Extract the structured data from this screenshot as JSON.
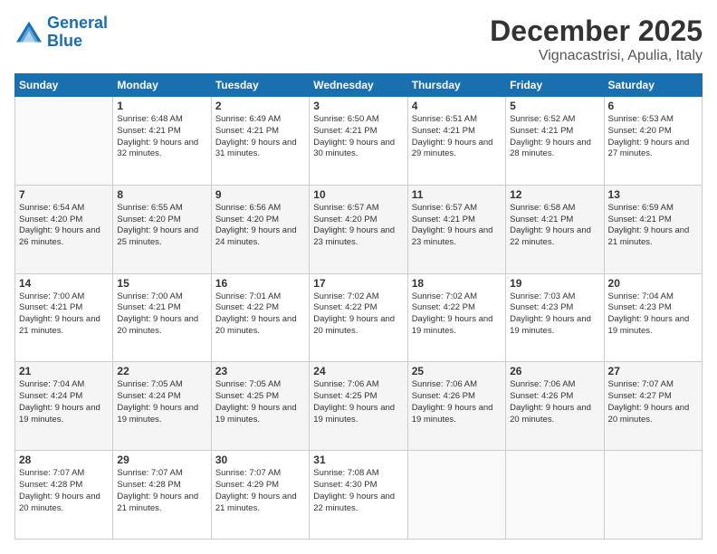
{
  "header": {
    "logo_line1": "General",
    "logo_line2": "Blue",
    "month_title": "December 2025",
    "location": "Vignacastrisi, Apulia, Italy"
  },
  "days_of_week": [
    "Sunday",
    "Monday",
    "Tuesday",
    "Wednesday",
    "Thursday",
    "Friday",
    "Saturday"
  ],
  "weeks": [
    [
      {
        "day": "",
        "info": ""
      },
      {
        "day": "1",
        "info": "Sunrise: 6:48 AM\nSunset: 4:21 PM\nDaylight: 9 hours\nand 32 minutes."
      },
      {
        "day": "2",
        "info": "Sunrise: 6:49 AM\nSunset: 4:21 PM\nDaylight: 9 hours\nand 31 minutes."
      },
      {
        "day": "3",
        "info": "Sunrise: 6:50 AM\nSunset: 4:21 PM\nDaylight: 9 hours\nand 30 minutes."
      },
      {
        "day": "4",
        "info": "Sunrise: 6:51 AM\nSunset: 4:21 PM\nDaylight: 9 hours\nand 29 minutes."
      },
      {
        "day": "5",
        "info": "Sunrise: 6:52 AM\nSunset: 4:21 PM\nDaylight: 9 hours\nand 28 minutes."
      },
      {
        "day": "6",
        "info": "Sunrise: 6:53 AM\nSunset: 4:20 PM\nDaylight: 9 hours\nand 27 minutes."
      }
    ],
    [
      {
        "day": "7",
        "info": "Sunrise: 6:54 AM\nSunset: 4:20 PM\nDaylight: 9 hours\nand 26 minutes."
      },
      {
        "day": "8",
        "info": "Sunrise: 6:55 AM\nSunset: 4:20 PM\nDaylight: 9 hours\nand 25 minutes."
      },
      {
        "day": "9",
        "info": "Sunrise: 6:56 AM\nSunset: 4:20 PM\nDaylight: 9 hours\nand 24 minutes."
      },
      {
        "day": "10",
        "info": "Sunrise: 6:57 AM\nSunset: 4:20 PM\nDaylight: 9 hours\nand 23 minutes."
      },
      {
        "day": "11",
        "info": "Sunrise: 6:57 AM\nSunset: 4:21 PM\nDaylight: 9 hours\nand 23 minutes."
      },
      {
        "day": "12",
        "info": "Sunrise: 6:58 AM\nSunset: 4:21 PM\nDaylight: 9 hours\nand 22 minutes."
      },
      {
        "day": "13",
        "info": "Sunrise: 6:59 AM\nSunset: 4:21 PM\nDaylight: 9 hours\nand 21 minutes."
      }
    ],
    [
      {
        "day": "14",
        "info": "Sunrise: 7:00 AM\nSunset: 4:21 PM\nDaylight: 9 hours\nand 21 minutes."
      },
      {
        "day": "15",
        "info": "Sunrise: 7:00 AM\nSunset: 4:21 PM\nDaylight: 9 hours\nand 20 minutes."
      },
      {
        "day": "16",
        "info": "Sunrise: 7:01 AM\nSunset: 4:22 PM\nDaylight: 9 hours\nand 20 minutes."
      },
      {
        "day": "17",
        "info": "Sunrise: 7:02 AM\nSunset: 4:22 PM\nDaylight: 9 hours\nand 20 minutes."
      },
      {
        "day": "18",
        "info": "Sunrise: 7:02 AM\nSunset: 4:22 PM\nDaylight: 9 hours\nand 19 minutes."
      },
      {
        "day": "19",
        "info": "Sunrise: 7:03 AM\nSunset: 4:23 PM\nDaylight: 9 hours\nand 19 minutes."
      },
      {
        "day": "20",
        "info": "Sunrise: 7:04 AM\nSunset: 4:23 PM\nDaylight: 9 hours\nand 19 minutes."
      }
    ],
    [
      {
        "day": "21",
        "info": "Sunrise: 7:04 AM\nSunset: 4:24 PM\nDaylight: 9 hours\nand 19 minutes."
      },
      {
        "day": "22",
        "info": "Sunrise: 7:05 AM\nSunset: 4:24 PM\nDaylight: 9 hours\nand 19 minutes."
      },
      {
        "day": "23",
        "info": "Sunrise: 7:05 AM\nSunset: 4:25 PM\nDaylight: 9 hours\nand 19 minutes."
      },
      {
        "day": "24",
        "info": "Sunrise: 7:06 AM\nSunset: 4:25 PM\nDaylight: 9 hours\nand 19 minutes."
      },
      {
        "day": "25",
        "info": "Sunrise: 7:06 AM\nSunset: 4:26 PM\nDaylight: 9 hours\nand 19 minutes."
      },
      {
        "day": "26",
        "info": "Sunrise: 7:06 AM\nSunset: 4:26 PM\nDaylight: 9 hours\nand 20 minutes."
      },
      {
        "day": "27",
        "info": "Sunrise: 7:07 AM\nSunset: 4:27 PM\nDaylight: 9 hours\nand 20 minutes."
      }
    ],
    [
      {
        "day": "28",
        "info": "Sunrise: 7:07 AM\nSunset: 4:28 PM\nDaylight: 9 hours\nand 20 minutes."
      },
      {
        "day": "29",
        "info": "Sunrise: 7:07 AM\nSunset: 4:28 PM\nDaylight: 9 hours\nand 21 minutes."
      },
      {
        "day": "30",
        "info": "Sunrise: 7:07 AM\nSunset: 4:29 PM\nDaylight: 9 hours\nand 21 minutes."
      },
      {
        "day": "31",
        "info": "Sunrise: 7:08 AM\nSunset: 4:30 PM\nDaylight: 9 hours\nand 22 minutes."
      },
      {
        "day": "",
        "info": ""
      },
      {
        "day": "",
        "info": ""
      },
      {
        "day": "",
        "info": ""
      }
    ]
  ]
}
